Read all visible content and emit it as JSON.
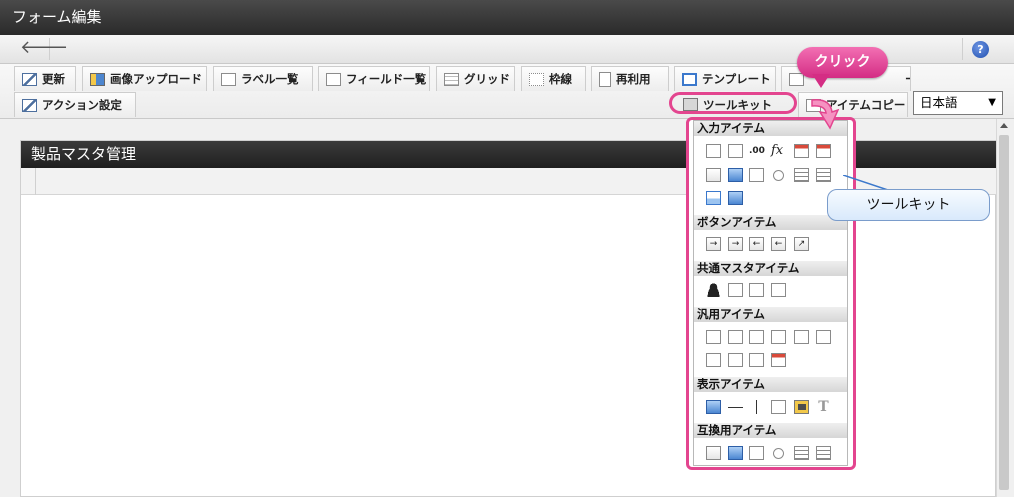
{
  "window": {
    "title": "フォーム編集"
  },
  "nav": {
    "back_symbol": "🡐",
    "help_symbol": "?"
  },
  "toolbar": {
    "row1": [
      "更新",
      "画像アップロード",
      "ラベル一覧",
      "フィールド一覧",
      "グリッド",
      "枠線",
      "再利用",
      "テンプレート",
      "",
      ""
    ],
    "row1_partial_right": "ー",
    "action_setting": "アクション設定",
    "toolkit": "ツールキット",
    "item_copy": "アイテムコピー",
    "language": {
      "selected": "日本語"
    }
  },
  "form": {
    "title": "製品マスタ管理"
  },
  "toolkit_panel": {
    "sections": [
      "入力アイテム",
      "ボタンアイテム",
      "共通マスタアイテム",
      "汎用アイテム",
      "表示アイテム",
      "互換用アイテム"
    ],
    "icon_text": {
      "fx": "fx",
      "num": ".00",
      "t": "T"
    }
  },
  "annotations": {
    "click": "クリック",
    "toolkit_label": "ツールキット"
  },
  "colors": {
    "highlight": "#e3458f",
    "callout_border": "#7a9ccb"
  }
}
